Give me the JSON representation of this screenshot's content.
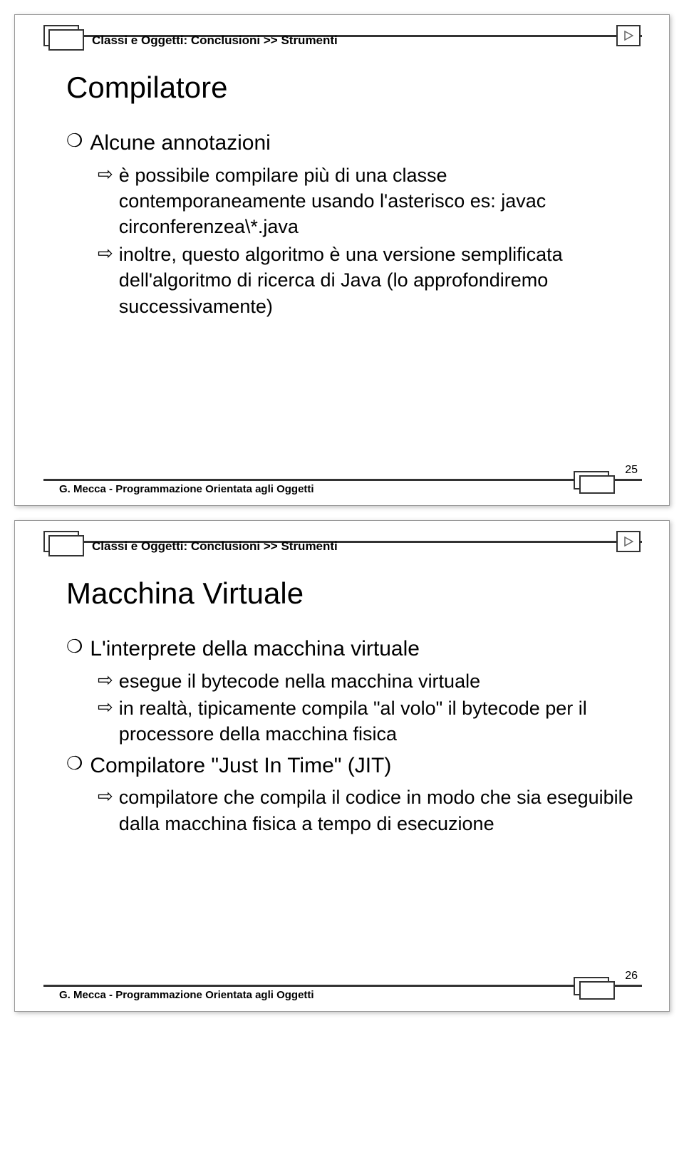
{
  "slides": [
    {
      "breadcrumb": "Classi e Oggetti: Conclusioni >> Strumenti",
      "title": "Compilatore",
      "footer": "G. Mecca - Programmazione Orientata agli Oggetti",
      "page": "25",
      "bullets": [
        {
          "level": 1,
          "text": "Alcune annotazioni"
        },
        {
          "level": 2,
          "text": "è possibile compilare più di una classe contemporaneamente usando l'asterisco es: javac circonferenzea\\*.java"
        },
        {
          "level": 2,
          "text": "inoltre, questo algoritmo è una versione semplificata dell'algoritmo di ricerca di Java (lo approfondiremo successivamente)"
        }
      ]
    },
    {
      "breadcrumb": "Classi e Oggetti: Conclusioni >> Strumenti",
      "title": "Macchina Virtuale",
      "footer": "G. Mecca - Programmazione Orientata agli Oggetti",
      "page": "26",
      "bullets": [
        {
          "level": 1,
          "text": "L'interprete della macchina virtuale"
        },
        {
          "level": 2,
          "text": "esegue il bytecode nella macchina virtuale"
        },
        {
          "level": 2,
          "text": "in realtà, tipicamente compila \"al volo\" il bytecode per il processore della macchina fisica"
        },
        {
          "level": 1,
          "text": "Compilatore \"Just In Time\" (JIT)"
        },
        {
          "level": 2,
          "text": "compilatore che compila il codice in modo che sia eseguibile dalla macchina fisica a tempo di esecuzione"
        }
      ]
    }
  ]
}
